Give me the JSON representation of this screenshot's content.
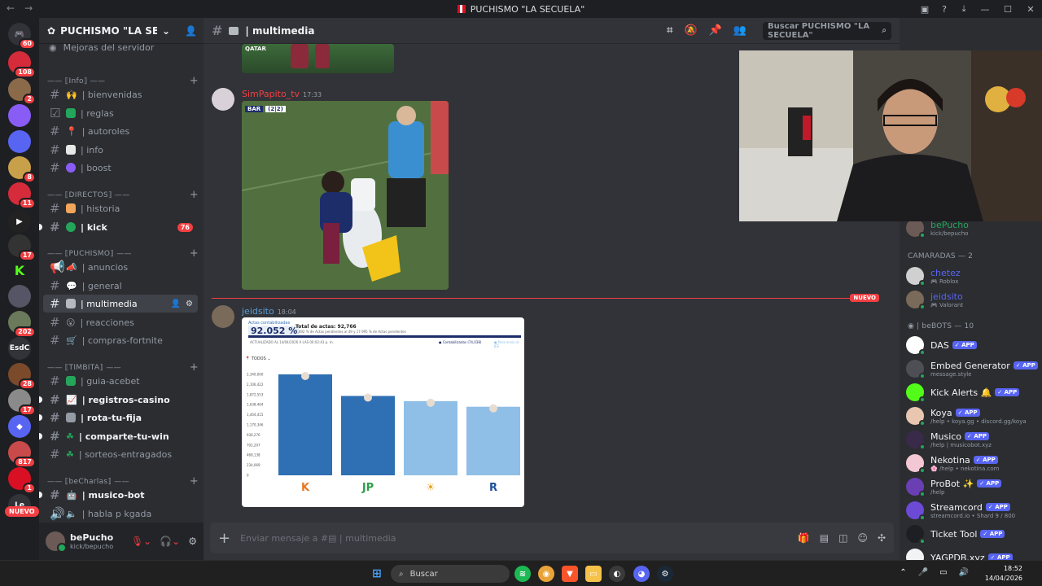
{
  "window": {
    "title": "PUCHISMO \"LA SECUELA\""
  },
  "server": {
    "name": "PUCHISMO \"LA SECUEL...",
    "boost_label": "Mejoras del servidor"
  },
  "guild_badges": [
    "60",
    "108",
    "2",
    "8",
    "11",
    "17",
    "202",
    "28",
    "17",
    "817",
    "1"
  ],
  "guild_labels": {
    "esdc": "EsdC",
    "le": "Le"
  },
  "nuevo_pill": "NUEVO",
  "categories": {
    "info": "—— ⟦Info⟧ ——",
    "directos": "—— ⟦DIRECTOS⟧ ——",
    "puchismo": "—— ⟦PUCHISMO⟧ ——",
    "timbita": "—— ⟦TIMBITA⟧ ——",
    "becharlas": "—— ⟦beCharlas⟧ ——"
  },
  "channels": [
    "| bienvenidas",
    "| reglas",
    "| autoroles",
    "| info",
    "| boost",
    "| historia",
    "| kick",
    "| anuncios",
    "| general",
    "| multimedia",
    "| reacciones",
    "| compras-fortnite",
    "| guia-acebet",
    "| registros-casino",
    "| rota-tu-fija",
    "| comparte-tu-win",
    "| sorteos-entragados",
    "| musico-bot",
    "| habla p kgada"
  ],
  "kick_count": "76",
  "user": {
    "name": "bePucho",
    "status": "kick/bepucho"
  },
  "chat": {
    "channel": "| multimedia",
    "search_placeholder": "Buscar PUCHISMO \"LA SECUELA\"",
    "composer_placeholder": "Enviar mensaje a #▤ | multimedia",
    "divider_badge": "NUEVO",
    "messages": [
      {
        "author": "SimPapito_tv",
        "time": "17:33",
        "overlay": "BAR",
        "score": "(2|2)",
        "color": "#f23f43"
      },
      {
        "author": "jeidsito",
        "time": "18:04",
        "color": "#5b9bd5"
      }
    ],
    "top_image_label": "QATAR"
  },
  "inner_chart": {
    "header_small": "Actas contabilizadas",
    "header_pct": "92.052 %",
    "total_actas": "Total de actas: 92,766",
    "actas_sub": "2,492 % de Actas pendientes al 49 y 17.995 % de Actas pendientes",
    "updated": "ACTUALIZADO AL 14/04/2026 A LAS 00:02:43 p. m.",
    "legend_1": "Contabilizadas (74,038)",
    "legend_2": "Para envio al JEE",
    "filter": "TODOS",
    "yticks": [
      "2,340,000",
      "2,106,422",
      "1,872,553",
      "1,638,464",
      "1,404,415",
      "1,170,346",
      "936,276",
      "702,207",
      "468,138",
      "234,069",
      "0"
    ],
    "bars": [
      {
        "label": "K",
        "value": 2340000,
        "color": "#2f6fb3"
      },
      {
        "label": "JP",
        "value": 1840000,
        "color": "#2f6fb3"
      },
      {
        "label": "☀",
        "value": 1720000,
        "color": "#8fbfe6"
      },
      {
        "label": "R",
        "value": 1590000,
        "color": "#8fbfe6"
      }
    ]
  },
  "members": {
    "top_member": {
      "name": "bePucho",
      "sub": "kick/bepucho"
    },
    "camaradas_title": "CAMARADAS — 2",
    "camaradas": [
      {
        "name": "chetez",
        "sub": "Roblox"
      },
      {
        "name": "jeidsito",
        "sub": "Valorant"
      }
    ],
    "bots_title": "◉ | beBOTS — 10",
    "bots": [
      {
        "name": "DAS",
        "sub": "",
        "tag": "✓ APP",
        "color": "#ffffff",
        "fg": "#111"
      },
      {
        "name": "Embed Generator",
        "sub": "message.style",
        "tag": "✓ APP",
        "color": "#4d4f55",
        "fg": "#fff"
      },
      {
        "name": "Kick Alerts 🔔",
        "sub": "",
        "tag": "✓ APP",
        "color": "#53fc18",
        "fg": "#111"
      },
      {
        "name": "Koya",
        "sub": "/help • koya.gg • discord.gg/koya",
        "tag": "✓ APP",
        "color": "#e8c6b0",
        "fg": "#111"
      },
      {
        "name": "Musico",
        "sub": "/help | musicobot.xyz",
        "tag": "✓ APP",
        "color": "#3a2a4a",
        "fg": "#fff"
      },
      {
        "name": "Nekotina",
        "sub": "🌸 /help • nekotina.com",
        "tag": "✓ APP",
        "color": "#f3c7d3",
        "fg": "#111"
      },
      {
        "name": "ProBot ✨",
        "sub": "/help",
        "tag": "✓ APP",
        "color": "#6a3fb3",
        "fg": "#fff"
      },
      {
        "name": "Streamcord",
        "sub": "streamcord.io • Shard 9 / 800",
        "tag": "✓ APP",
        "color": "#6c4ad6",
        "fg": "#fff"
      },
      {
        "name": "Ticket Tool",
        "sub": "",
        "tag": "✓ APP",
        "color": "#1e1f22",
        "fg": "#fff"
      },
      {
        "name": "YAGPDB.xyz",
        "sub": "",
        "tag": "✓ APP",
        "color": "#f2f3f5",
        "fg": "#111"
      }
    ]
  },
  "taskbar": {
    "search": "Buscar",
    "time": "18:52",
    "date": "14/04/2026"
  },
  "colors": {
    "accent": "#5865f2",
    "danger": "#f23f43",
    "online": "#23a55a"
  }
}
